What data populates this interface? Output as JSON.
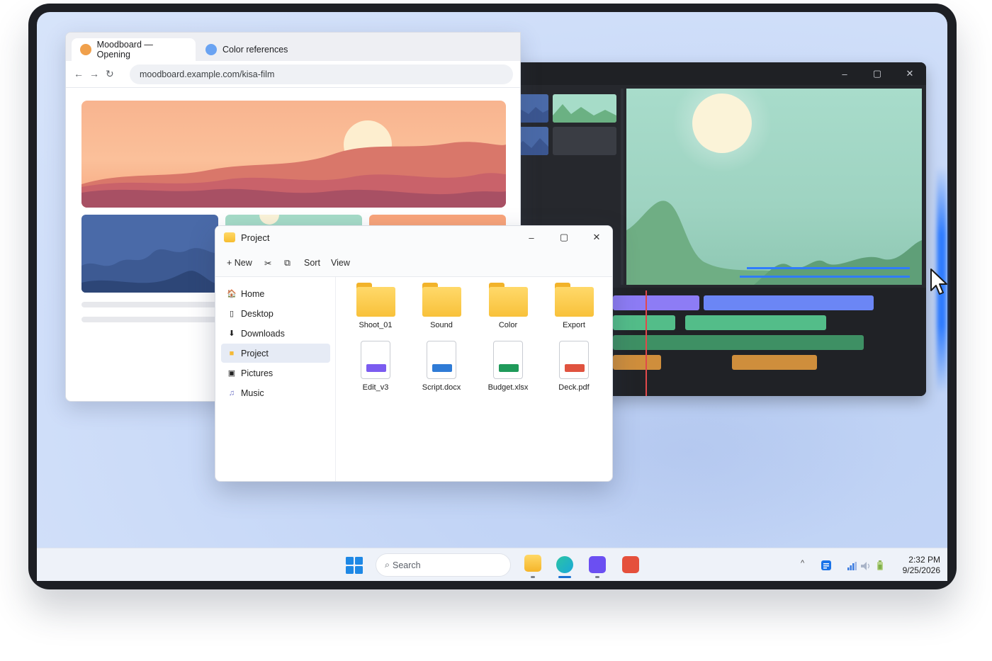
{
  "browser": {
    "tabs": [
      {
        "label": "Moodboard — Opening",
        "color": "#f0a04b"
      },
      {
        "label": "Color references",
        "color": "#6aa3f2"
      }
    ],
    "address": "moodboard.example.com/kisa-film",
    "icons": [
      "back-arrow-icon",
      "forward-arrow-icon",
      "reload-icon"
    ]
  },
  "editor": {
    "controls": {
      "minimize": "–",
      "maximize": "▢",
      "close": "✕"
    }
  },
  "explorer": {
    "title": "Project",
    "toolbar": {
      "new": "New",
      "sort": "Sort",
      "view": "View"
    },
    "controls": {
      "minimize": "–",
      "maximize": "▢",
      "close": "✕"
    },
    "sidebar": [
      {
        "label": "Home",
        "icon": "home-icon"
      },
      {
        "label": "Desktop",
        "icon": "desktop-icon"
      },
      {
        "label": "Downloads",
        "icon": "download-icon"
      },
      {
        "label": "Project",
        "icon": "folder-icon",
        "selected": true
      },
      {
        "label": "Pictures",
        "icon": "pictures-icon"
      },
      {
        "label": "Music",
        "icon": "music-icon"
      }
    ],
    "folders": [
      {
        "label": "Shoot_01"
      },
      {
        "label": "Sound"
      },
      {
        "label": "Color"
      },
      {
        "label": "Export"
      }
    ],
    "files": [
      {
        "label": "Edit_v3",
        "color": "#7b5cf0"
      },
      {
        "label": "Script.docx",
        "color": "#2f7bd6"
      },
      {
        "label": "Budget.xlsx",
        "color": "#1f9a5a"
      },
      {
        "label": "Deck.pdf",
        "color": "#e0533f"
      }
    ]
  },
  "taskbar": {
    "search_placeholder": "Search",
    "apps": [
      {
        "name": "file-explorer-app",
        "color": "#f7bd30"
      },
      {
        "name": "browser-app",
        "color": "#1fb6c9"
      },
      {
        "name": "video-editor-app",
        "color": "#6b4ff2"
      },
      {
        "name": "presentation-app",
        "color": "#e5503c"
      }
    ],
    "time": "2:32 PM",
    "date": "9/25/2026",
    "tray_chevron": "^"
  }
}
